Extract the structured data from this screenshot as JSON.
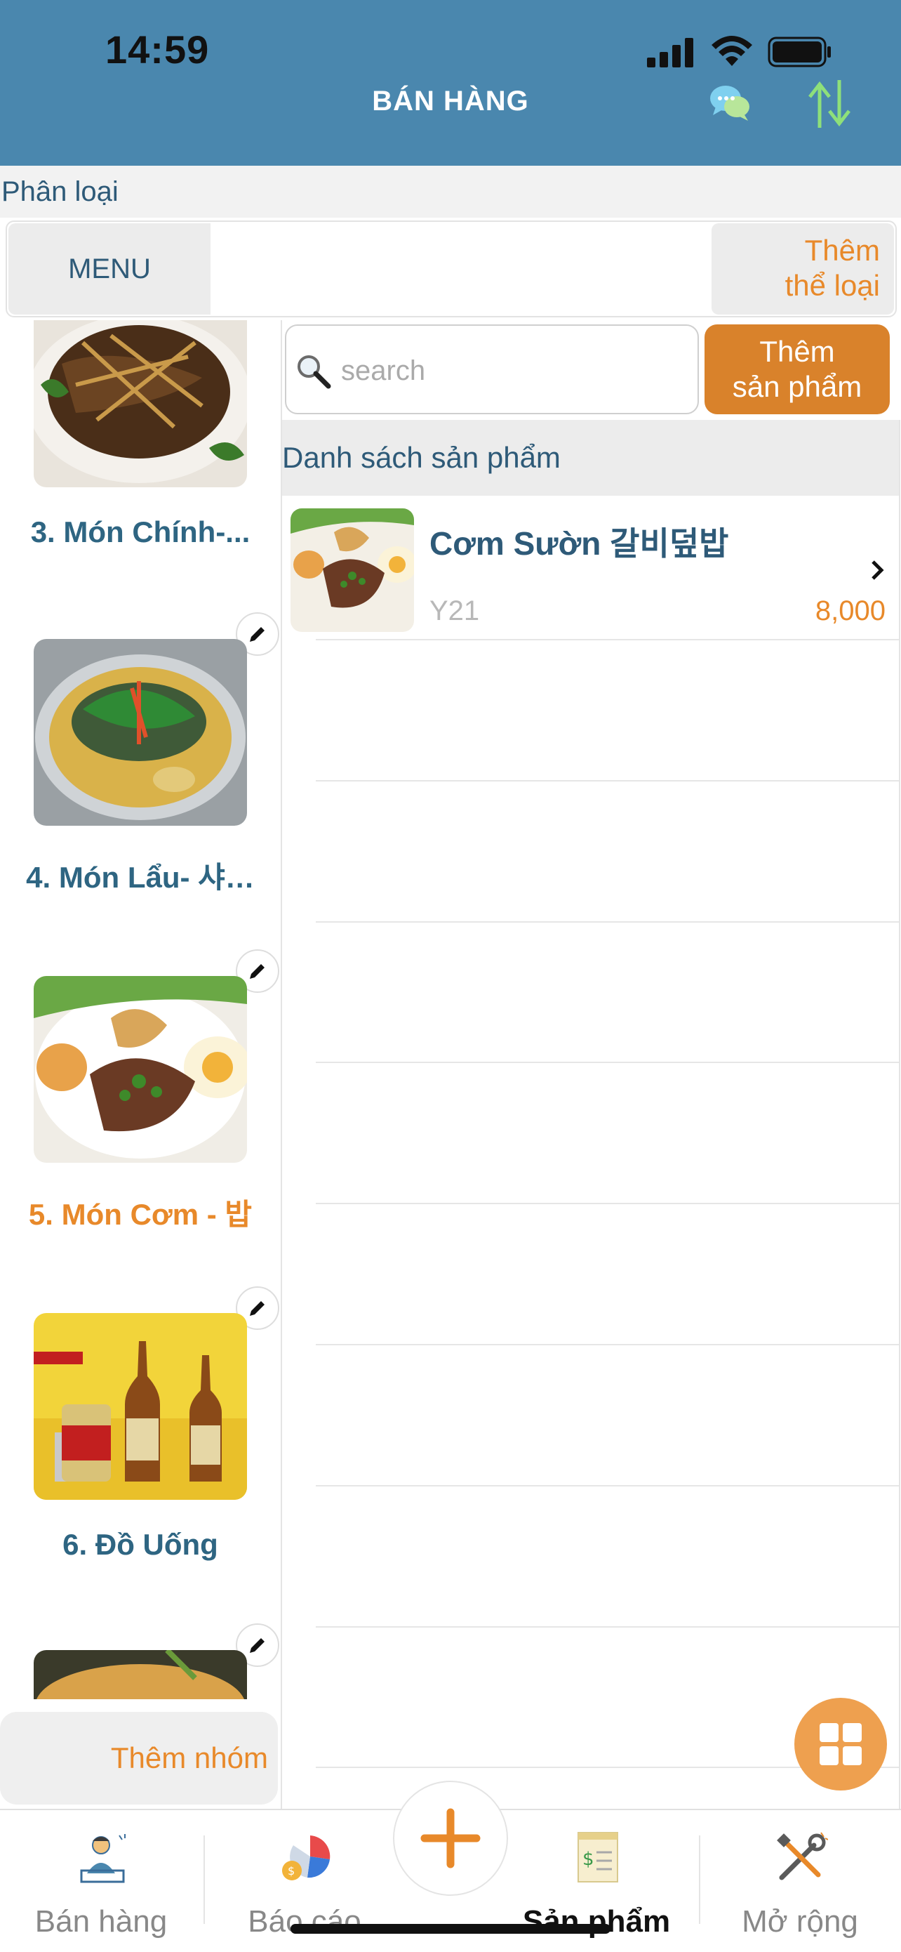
{
  "status_bar": {
    "time": "14:59"
  },
  "header": {
    "title": "BÁN HÀNG"
  },
  "category": {
    "section_label": "Phân loại",
    "menu_label": "MENU",
    "add_label_line1": "Thêm",
    "add_label_line2": "thể loại"
  },
  "groups": {
    "items": [
      {
        "label": "3. Món Chính-...",
        "active": false
      },
      {
        "label": "4. Món Lẩu- 샤…",
        "active": false
      },
      {
        "label": "5. Món Cơm - 밥",
        "active": true
      },
      {
        "label": "6. Đồ Uống",
        "active": false
      }
    ],
    "add_label": "Thêm nhóm"
  },
  "products": {
    "search_placeholder": "search",
    "add_label_line1": "Thêm",
    "add_label_line2": "sản phẩm",
    "list_header": "Danh sách sản phẩm",
    "items": [
      {
        "name": "Cơm Sườn 갈비덮밥",
        "code": "Y21",
        "price": "8,000"
      }
    ]
  },
  "tabbar": {
    "tabs": [
      {
        "label": "Bán hàng",
        "icon": "cashier-icon",
        "active": false
      },
      {
        "label": "Báo cáo",
        "icon": "report-chart-icon",
        "active": false
      },
      {
        "label": "Sản phẩm",
        "icon": "product-receipt-icon",
        "active": true
      },
      {
        "label": "Mở rộng",
        "icon": "tools-icon",
        "active": false
      }
    ]
  },
  "colors": {
    "header": "#4a87ae",
    "accent_orange": "#e8892a",
    "text_blue": "#2e5a78"
  }
}
